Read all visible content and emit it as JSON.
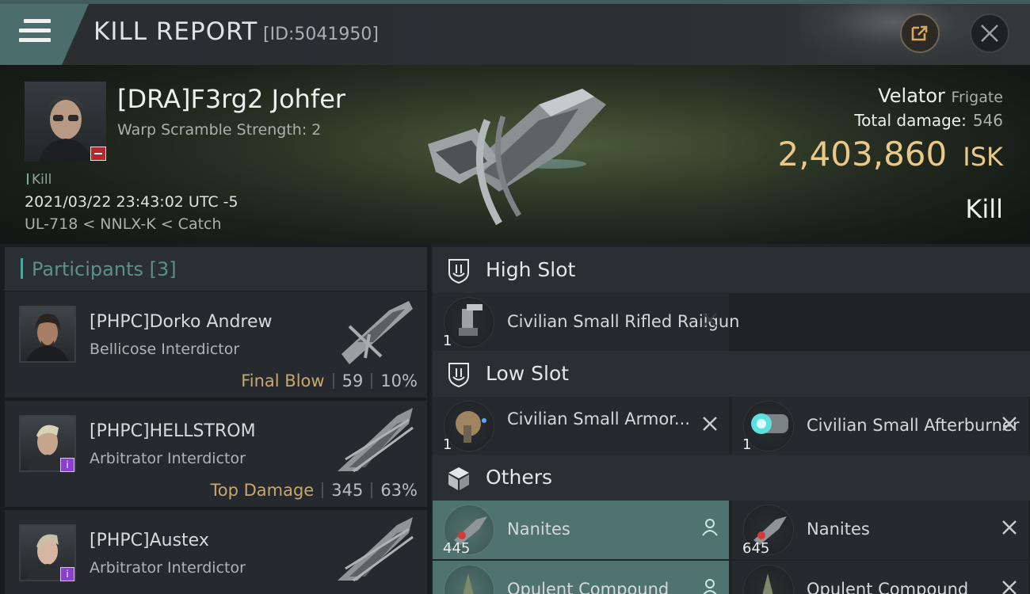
{
  "header": {
    "title": "KILL REPORT",
    "id_label": "[ID:5041950]"
  },
  "victim": {
    "name": "[DRA]F3rg2 Johfer",
    "detail": "Warp Scramble Strength: 2",
    "kill_tag": "Kill",
    "datetime": "2021/03/22 23:43:02 UTC -5",
    "location": "UL-718 < NNLX-K < Catch"
  },
  "summary": {
    "ship": "Velator",
    "ship_class": "Frigate",
    "damage_label": "Total damage:",
    "damage_value": "546",
    "isk_value": "2,403,860",
    "isk_unit": "ISK",
    "result": "Kill"
  },
  "participants": {
    "label": "Participants",
    "count": "[3]",
    "items": [
      {
        "name": "[PHPC]Dorko Andrew",
        "ship": "Bellicose Interdictor",
        "tag": "Final Blow",
        "damage": "59",
        "percent": "10%"
      },
      {
        "name": "[PHPC]HELLSTROM",
        "ship": "Arbitrator Interdictor",
        "tag": "Top Damage",
        "damage": "345",
        "percent": "63%"
      },
      {
        "name": "[PHPC]Austex",
        "ship": "Arbitrator Interdictor",
        "tag": "",
        "damage": "",
        "percent": ""
      }
    ]
  },
  "slots": {
    "high": {
      "label": "High Slot",
      "items": [
        {
          "name": "Civilian Small Rifled Railgun",
          "qty": "1"
        }
      ]
    },
    "low": {
      "label": "Low Slot",
      "items": [
        {
          "name": "Civilian Small Armor...",
          "qty": "1"
        },
        {
          "name": "Civilian Small Afterburner",
          "qty": "1"
        }
      ]
    },
    "others": {
      "label": "Others",
      "items": [
        {
          "name": "Nanites",
          "qty": "445"
        },
        {
          "name": "Nanites",
          "qty": "645"
        },
        {
          "name": "Opulent Compound",
          "qty": ""
        },
        {
          "name": "Opulent Compound",
          "qty": ""
        }
      ]
    }
  },
  "icons": {
    "menu": "hamburger-icon",
    "share": "external-link-icon",
    "close": "close-icon",
    "slot": "shield-icon",
    "others": "cube-icon",
    "remove": "x-icon",
    "person": "person-icon"
  },
  "colors": {
    "accent": "#4ea6a0",
    "isk": "#e9c888",
    "highlight": "#4f7470",
    "final_blow": "#c9a76a"
  }
}
